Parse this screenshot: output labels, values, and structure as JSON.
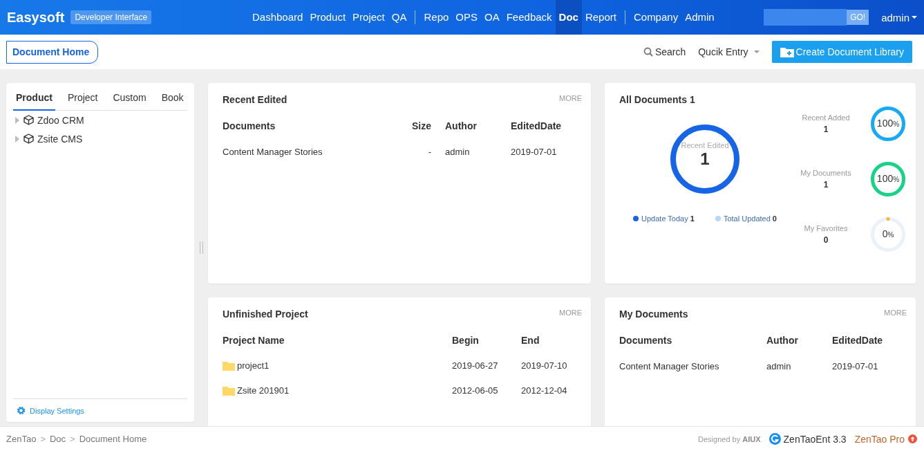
{
  "header": {
    "brand": "Easysoft",
    "badge": "Developer Interface",
    "nav_groups": [
      [
        {
          "label": "Dashboard",
          "selected": false
        },
        {
          "label": "Product",
          "selected": false
        },
        {
          "label": "Project",
          "selected": false
        },
        {
          "label": "QA",
          "selected": false
        }
      ],
      [
        {
          "label": "Repo",
          "selected": false
        },
        {
          "label": "OPS",
          "selected": false
        },
        {
          "label": "OA",
          "selected": false
        },
        {
          "label": "Feedback",
          "selected": false
        },
        {
          "label": "Doc",
          "selected": true
        },
        {
          "label": "Report",
          "selected": false
        }
      ],
      [
        {
          "label": "Company",
          "selected": false
        },
        {
          "label": "Admin",
          "selected": false
        }
      ]
    ],
    "search_button": "GO!",
    "user": "admin"
  },
  "subheader": {
    "breadcrumb": "Document Home",
    "search": "Search",
    "quick_entry": "Qucik Entry",
    "create_button": "Create Document Library"
  },
  "sidebar": {
    "tabs": [
      {
        "label": "Product",
        "selected": true
      },
      {
        "label": "Project",
        "selected": false
      },
      {
        "label": "Custom",
        "selected": false
      },
      {
        "label": "Book",
        "selected": false
      }
    ],
    "tree": [
      {
        "label": "Zdoo CRM",
        "expanded": false
      },
      {
        "label": "Zsite CMS",
        "expanded": false
      }
    ],
    "settings_link": "Display Settings"
  },
  "recent_edited": {
    "title": "Recent Edited",
    "more": "MORE",
    "columns": [
      "Documents",
      "Size",
      "Author",
      "EditedDate"
    ],
    "rows": [
      [
        "Content Manager Stories",
        "-",
        "admin",
        "2019-07-01"
      ]
    ]
  },
  "all_documents": {
    "title": "All Documents 1",
    "main_ring": {
      "label": "Recent Edited",
      "value": "1",
      "level": 1
    },
    "legend": [
      {
        "label": "Update Today",
        "value": "1",
        "color": "#1565e6"
      },
      {
        "label": "Total Updated",
        "value": "0",
        "color": "#bcd6f5"
      }
    ],
    "stats": [
      {
        "label": "Recent Added",
        "value": "1",
        "percent": "100",
        "unit": "%",
        "level": 1,
        "color": "#16a9f5"
      },
      {
        "label": "My Documents",
        "value": "1",
        "percent": "100",
        "unit": "%",
        "level": 1,
        "color": "#17d287"
      },
      {
        "label": "My Favorites",
        "value": "0",
        "percent": "0",
        "unit": "%",
        "level": 0,
        "color": "#f9b82b"
      }
    ]
  },
  "unfinished_project": {
    "title": "Unfinished Project",
    "more": "MORE",
    "columns": [
      "Project Name",
      "Begin",
      "End"
    ],
    "rows": [
      [
        "project1",
        "2019-06-27",
        "2019-07-10"
      ],
      [
        "Zsite 201901",
        "2012-06-05",
        "2012-12-04"
      ]
    ]
  },
  "my_documents": {
    "title": "My Documents",
    "more": "MORE",
    "columns": [
      "Documents",
      "Author",
      "EditedDate"
    ],
    "rows": [
      [
        "Content Manager Stories",
        "admin",
        "2019-07-01"
      ]
    ]
  },
  "footer": {
    "breadcrumb": [
      "ZenTao",
      "Doc",
      "Document Home"
    ],
    "separator": ">",
    "designed_by": "Designed by",
    "designer": "AIUX",
    "version": "ZenTaoEnt 3.3",
    "pro": "ZenTao Pro"
  }
}
